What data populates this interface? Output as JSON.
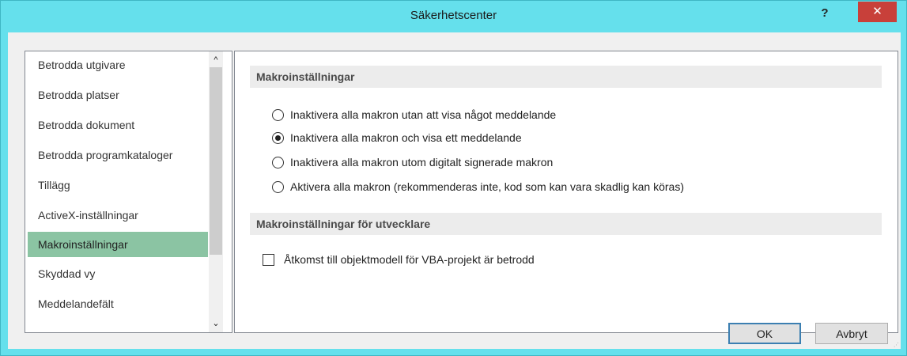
{
  "window": {
    "title": "Säkerhetscenter",
    "help_label": "?",
    "close_label": "✕"
  },
  "sidebar": {
    "items": [
      {
        "label": "Betrodda utgivare"
      },
      {
        "label": "Betrodda platser"
      },
      {
        "label": "Betrodda dokument"
      },
      {
        "label": "Betrodda programkataloger"
      },
      {
        "label": "Tillägg"
      },
      {
        "label": "ActiveX-inställningar"
      },
      {
        "label": "Makroinställningar",
        "selected": true
      },
      {
        "label": "Skyddad vy"
      },
      {
        "label": "Meddelandefält"
      }
    ],
    "selected_color": "#8bc4a3",
    "scroll_up": "^",
    "scroll_down": "⌄"
  },
  "main": {
    "section1": {
      "title": "Makroinställningar",
      "options": [
        {
          "label": "Inaktivera alla makron utan att visa något meddelande",
          "checked": false
        },
        {
          "label": "Inaktivera alla makron och visa ett meddelande",
          "checked": true
        },
        {
          "label": "Inaktivera alla makron utom digitalt signerade makron",
          "checked": false
        },
        {
          "label": "Aktivera alla makron (rekommenderas inte, kod som kan vara skadlig kan köras)",
          "checked": false
        }
      ]
    },
    "section2": {
      "title": "Makroinställningar för utvecklare",
      "checkbox_label": "Åtkomst till objektmodell för VBA-projekt är betrodd",
      "checkbox_checked": false
    }
  },
  "buttons": {
    "ok": "OK",
    "cancel": "Avbryt"
  },
  "colors": {
    "titlebar": "#65e0ec",
    "close_button": "#c8403a"
  }
}
